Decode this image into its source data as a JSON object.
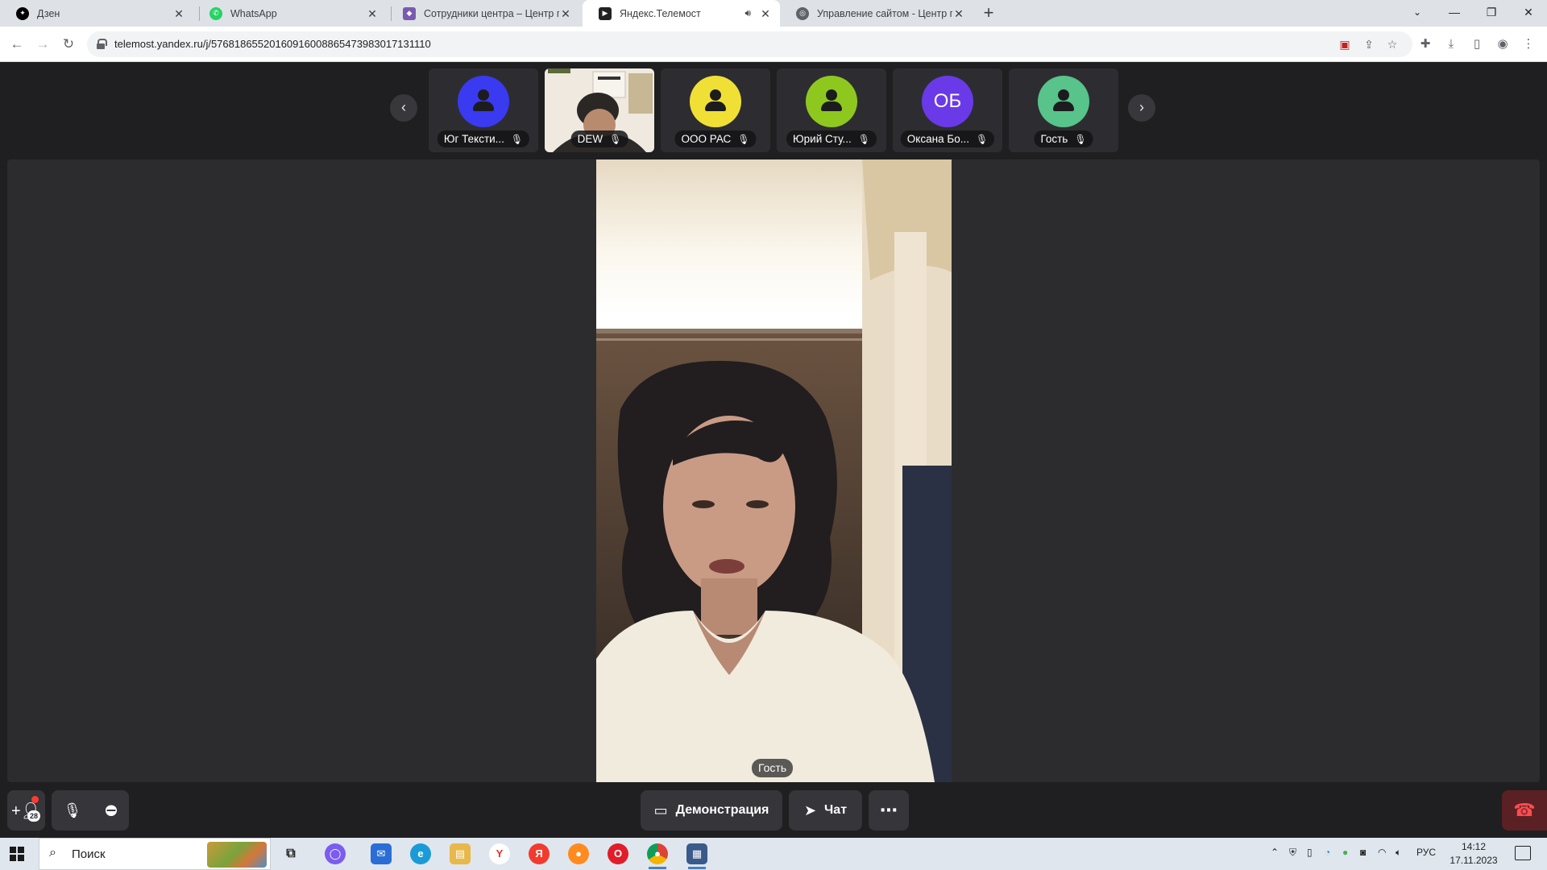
{
  "browser": {
    "tabs": [
      {
        "title": "Дзен",
        "icon": "dzen-icon",
        "icon_color": "#000000",
        "active": false,
        "audio": false
      },
      {
        "title": "WhatsApp",
        "icon": "whatsapp-icon",
        "icon_color": "#25d366",
        "active": false,
        "audio": false
      },
      {
        "title": "Сотрудники центра – Центр по",
        "icon": "site-logo-icon",
        "icon_color": "#7a5ab0",
        "active": false,
        "audio": false
      },
      {
        "title": "Яндекс.Телемост",
        "icon": "telemost-icon",
        "icon_color": "#222222",
        "active": true,
        "audio": true
      },
      {
        "title": "Управление сайтом - Центр по",
        "icon": "globe-icon",
        "icon_color": "#5f6368",
        "active": false,
        "audio": false
      }
    ],
    "url": "telemost.yandex.ru/j/57681865520160916008865473983017131110"
  },
  "participants": [
    {
      "name": "Юг Тексти...",
      "type": "avatar",
      "avatar_color": "#3a3af0",
      "initials": "",
      "muted": true
    },
    {
      "name": "DEW",
      "type": "video",
      "avatar_color": "",
      "initials": "",
      "muted": true
    },
    {
      "name": "ООО РАС",
      "type": "avatar",
      "avatar_color": "#f0e036",
      "initials": "",
      "muted": true
    },
    {
      "name": "Юрий Сту...",
      "type": "avatar",
      "avatar_color": "#8ec81f",
      "initials": "",
      "muted": true
    },
    {
      "name": "Оксана Бо...",
      "type": "avatar",
      "avatar_color": "#6a3ae8",
      "initials": "ОБ",
      "muted": true
    },
    {
      "name": "Гость",
      "type": "avatar",
      "avatar_color": "#58c38a",
      "initials": "",
      "muted": true
    }
  ],
  "main_speaker": {
    "name": "Гость"
  },
  "controls": {
    "participants_count": "28",
    "demo_label": "Демонстрация",
    "chat_label": "Чат"
  },
  "taskbar": {
    "search_placeholder": "Поиск",
    "language": "РУС",
    "time": "14:12",
    "date": "17.11.2023"
  }
}
